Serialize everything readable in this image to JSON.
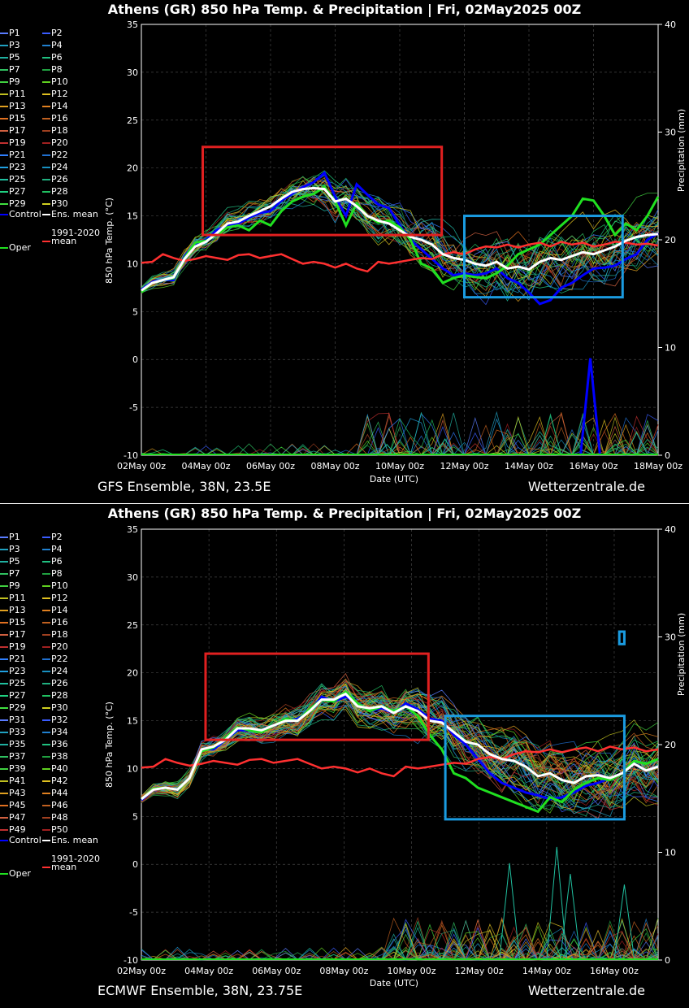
{
  "chart_data": [
    {
      "type": "line",
      "title": "Athens  (GR)  850 hPa Temp. & Precipitation | Fri, 02May2025 00Z",
      "xlabel": "Date (UTC)",
      "ylabel": "850 hPa Temp. (°C)",
      "y2label": "Precipitation (mm)",
      "ylim": [
        -10,
        35
      ],
      "y2lim": [
        0,
        40
      ],
      "yticks": [
        "35",
        "30",
        "25",
        "20",
        "15",
        "10",
        "5",
        "0",
        "-5",
        "-10"
      ],
      "y2ticks": [
        "40",
        "30",
        "20",
        "10",
        "0"
      ],
      "xticks": [
        "02May 00z",
        "04May 00z",
        "06May 00z",
        "08May 00z",
        "10May 00z",
        "12May 00z",
        "14May 00z",
        "16May 00z",
        "18May 00z"
      ],
      "members": 30,
      "source_left": "GFS Ensemble, 38N, 23.5E",
      "source_right": "Wetterzentrale.de",
      "legend": [
        "P1",
        "P2",
        "P3",
        "P4",
        "P5",
        "P6",
        "P7",
        "P8",
        "P9",
        "P10",
        "P11",
        "P12",
        "P13",
        "P14",
        "P15",
        "P16",
        "P17",
        "P18",
        "P19",
        "P20",
        "P21",
        "P22",
        "P23",
        "P24",
        "P25",
        "P26",
        "P27",
        "P28",
        "P29",
        "P30",
        "Control",
        "Ens. mean",
        "1991-2020\nmean",
        "Oper"
      ],
      "series": [
        {
          "name": "Ens. mean",
          "values": [
            7.2,
            8.0,
            8.3,
            8.6,
            10.5,
            11.8,
            12.3,
            13.2,
            14.2,
            14.4,
            15.0,
            15.5,
            16.0,
            16.8,
            17.5,
            17.8,
            17.9,
            17.8,
            16.5,
            16.8,
            16.0,
            15.0,
            14.5,
            14.2,
            13.5,
            12.8,
            12.5,
            12.0,
            11.0,
            10.6,
            10.4,
            10.0,
            9.8,
            10.2,
            9.5,
            9.7,
            9.4,
            10.2,
            10.6,
            10.4,
            10.8,
            11.2,
            11.0,
            11.4,
            11.8,
            12.4,
            12.8,
            13.0,
            13.1
          ]
        },
        {
          "name": "Control",
          "values": [
            7.3,
            8.1,
            8.3,
            8.3,
            10.8,
            12.0,
            12.5,
            13.5,
            14.0,
            14.2,
            14.8,
            15.3,
            15.5,
            16.6,
            17.3,
            18.0,
            18.5,
            19.5,
            17.0,
            15.0,
            18.3,
            17.2,
            16.2,
            15.8,
            14.0,
            12.5,
            11.5,
            10.5,
            9.5,
            8.8,
            9.0,
            8.8,
            9.0,
            9.5,
            8.5,
            8.0,
            7.0,
            5.8,
            6.2,
            7.5,
            8.0,
            8.8,
            9.5,
            9.6,
            9.8,
            10.5,
            11.0,
            12.5,
            13.2
          ]
        },
        {
          "name": "Oper",
          "values": [
            7.0,
            8.0,
            8.3,
            8.5,
            10.6,
            12.2,
            12.4,
            13.0,
            13.8,
            14.0,
            13.5,
            14.5,
            14.0,
            15.5,
            16.5,
            17.0,
            17.3,
            18.0,
            16.5,
            14.0,
            16.3,
            15.0,
            14.3,
            14.5,
            13.8,
            12.5,
            10.0,
            9.5,
            8.0,
            8.5,
            8.8,
            8.6,
            8.5,
            9.0,
            9.8,
            11.0,
            11.5,
            12.0,
            13.0,
            14.0,
            15.0,
            16.8,
            16.6,
            15.0,
            13.0,
            14.2,
            13.5,
            15.0,
            17.0
          ]
        },
        {
          "name": "1991-2020\nmean",
          "values": [
            10.1,
            10.2,
            11.0,
            10.6,
            10.3,
            10.5,
            10.8,
            10.6,
            10.4,
            10.9,
            11.0,
            10.6,
            10.8,
            11.0,
            10.5,
            10.0,
            10.2,
            10.0,
            9.6,
            10.0,
            9.5,
            9.2,
            10.2,
            10.0,
            10.2,
            10.4,
            10.6,
            10.5,
            11.0,
            11.2,
            11.0,
            11.5,
            11.8,
            11.7,
            12.0,
            11.7,
            12.0,
            12.2,
            11.8,
            12.3,
            12.0,
            12.2,
            11.8,
            12.0,
            12.3,
            12.2,
            12.0,
            12.1,
            11.9
          ]
        }
      ],
      "precip_spikes": [
        {
          "day": 13.9,
          "value": 9.0
        },
        {
          "day": 9.4,
          "value": 1.5
        },
        {
          "day": 7.6,
          "value": 1.0
        }
      ],
      "annotations": [
        {
          "shape": "rectangle",
          "color": "#e02020",
          "x_days": [
            1.9,
            9.3
          ],
          "y": [
            13.0,
            22.2
          ]
        },
        {
          "shape": "rectangle",
          "color": "#1a9be0",
          "x_days": [
            10.0,
            14.9
          ],
          "y": [
            6.5,
            15.0
          ]
        }
      ]
    },
    {
      "type": "line",
      "title": "Athens  (GR)  850 hPa Temp. & Precipitation | Fri, 02May2025 00Z",
      "xlabel": "Date (UTC)",
      "ylabel": "850 hPa Temp. (°C)",
      "y2label": "Precipitation (mm)",
      "ylim": [
        -10,
        35
      ],
      "y2lim": [
        0,
        40
      ],
      "yticks": [
        "35",
        "30",
        "25",
        "20",
        "15",
        "10",
        "5",
        "0",
        "-5",
        "-10"
      ],
      "y2ticks": [
        "40",
        "30",
        "20",
        "10",
        "0"
      ],
      "xticks": [
        "02May 00z",
        "04May 00z",
        "06May 00z",
        "08May 00z",
        "10May 00z",
        "12May 00z",
        "14May 00z",
        "16May 00z"
      ],
      "members": 50,
      "source_left": "ECMWF Ensemble, 38N, 23.75E",
      "source_right": "Wetterzentrale.de",
      "legend": [
        "P1",
        "P2",
        "P3",
        "P4",
        "P5",
        "P6",
        "P7",
        "P8",
        "P9",
        "P10",
        "P11",
        "P12",
        "P13",
        "P14",
        "P15",
        "P16",
        "P17",
        "P18",
        "P19",
        "P20",
        "P21",
        "P22",
        "P23",
        "P24",
        "P25",
        "P26",
        "P27",
        "P28",
        "P29",
        "P30",
        "P31",
        "P32",
        "P33",
        "P34",
        "P35",
        "P36",
        "P37",
        "P38",
        "P39",
        "P40",
        "P41",
        "P42",
        "P43",
        "P44",
        "P45",
        "P46",
        "P47",
        "P48",
        "P49",
        "P50",
        "Control",
        "Ens. mean",
        "1991-2020\nmean",
        "Oper"
      ],
      "series": [
        {
          "name": "Ens. mean",
          "values": [
            6.8,
            7.8,
            8.0,
            7.8,
            9.0,
            12.0,
            12.3,
            13.0,
            14.2,
            14.2,
            14.0,
            14.5,
            15.0,
            15.0,
            16.0,
            17.2,
            17.2,
            17.8,
            16.5,
            16.3,
            16.5,
            15.8,
            16.5,
            16.0,
            15.0,
            14.8,
            13.8,
            12.8,
            12.5,
            11.5,
            11.0,
            10.8,
            10.2,
            9.2,
            9.5,
            8.8,
            8.5,
            9.2,
            9.3,
            9.0,
            9.5,
            10.5,
            9.8,
            10.2
          ]
        },
        {
          "name": "Control",
          "values": [
            6.7,
            7.8,
            8.0,
            7.8,
            9.0,
            12.0,
            12.0,
            13.0,
            14.0,
            14.0,
            14.0,
            14.5,
            15.0,
            15.2,
            16.0,
            17.5,
            17.0,
            17.5,
            16.8,
            16.0,
            16.3,
            15.8,
            16.8,
            16.2,
            15.2,
            15.0,
            13.5,
            12.5,
            11.0,
            9.5,
            8.5,
            8.0,
            7.5,
            7.2,
            6.8,
            7.0,
            7.5,
            8.2,
            8.5,
            9.0,
            9.5,
            10.5,
            9.8,
            10.2
          ]
        },
        {
          "name": "Oper",
          "values": [
            6.8,
            7.9,
            8.0,
            7.8,
            9.0,
            11.8,
            12.2,
            13.2,
            14.3,
            14.0,
            13.8,
            14.5,
            15.2,
            15.0,
            16.2,
            17.2,
            17.0,
            18.0,
            16.8,
            16.0,
            16.5,
            16.0,
            16.5,
            15.5,
            13.5,
            12.0,
            9.5,
            9.0,
            8.0,
            7.5,
            7.0,
            6.5,
            6.0,
            5.5,
            7.0,
            6.5,
            7.8,
            8.5,
            9.0,
            8.8,
            9.5,
            10.8,
            10.5,
            11.0
          ]
        },
        {
          "name": "1991-2020\nmean",
          "values": [
            10.1,
            10.2,
            11.0,
            10.6,
            10.3,
            10.5,
            10.8,
            10.6,
            10.4,
            10.9,
            11.0,
            10.6,
            10.8,
            11.0,
            10.5,
            10.0,
            10.2,
            10.0,
            9.6,
            10.0,
            9.5,
            9.2,
            10.2,
            10.0,
            10.2,
            10.4,
            10.6,
            10.5,
            11.0,
            11.2,
            11.0,
            11.5,
            11.8,
            11.7,
            12.0,
            11.7,
            12.0,
            12.2,
            11.8,
            12.3,
            12.0,
            12.2,
            11.8,
            12.0
          ]
        }
      ],
      "precip_spikes": [
        {
          "day": 10.9,
          "value": 9.0
        },
        {
          "day": 12.3,
          "value": 10.5
        },
        {
          "day": 12.7,
          "value": 8.0
        },
        {
          "day": 14.3,
          "value": 7.0
        }
      ],
      "annotations": [
        {
          "shape": "rectangle",
          "color": "#e02020",
          "x_days": [
            1.9,
            8.5
          ],
          "y": [
            13.0,
            22.0
          ]
        },
        {
          "shape": "rectangle",
          "color": "#1a9be0",
          "x_days": [
            9.0,
            14.3
          ],
          "y": [
            4.7,
            15.5
          ]
        },
        {
          "shape": "rectangle",
          "color": "#1a9be0",
          "x_days": [
            14.15,
            14.3
          ],
          "y": [
            23.0,
            24.3
          ]
        }
      ]
    }
  ],
  "member_colors": [
    "#5a7cff",
    "#3a5cff",
    "#20a0c0",
    "#2080d0",
    "#20b0a0",
    "#20c080",
    "#30c060",
    "#20a040",
    "#40d040",
    "#60d020",
    "#c0c020",
    "#e0c020",
    "#e0a020",
    "#e08020",
    "#e07020",
    "#c06020",
    "#d06040",
    "#a04020",
    "#c03030",
    "#a02020",
    "#3080ff",
    "#2070d0",
    "#20a0e0",
    "#1890c0",
    "#20c0a0",
    "#20b080",
    "#20d080",
    "#20c060",
    "#40e040",
    "#d0d020"
  ]
}
